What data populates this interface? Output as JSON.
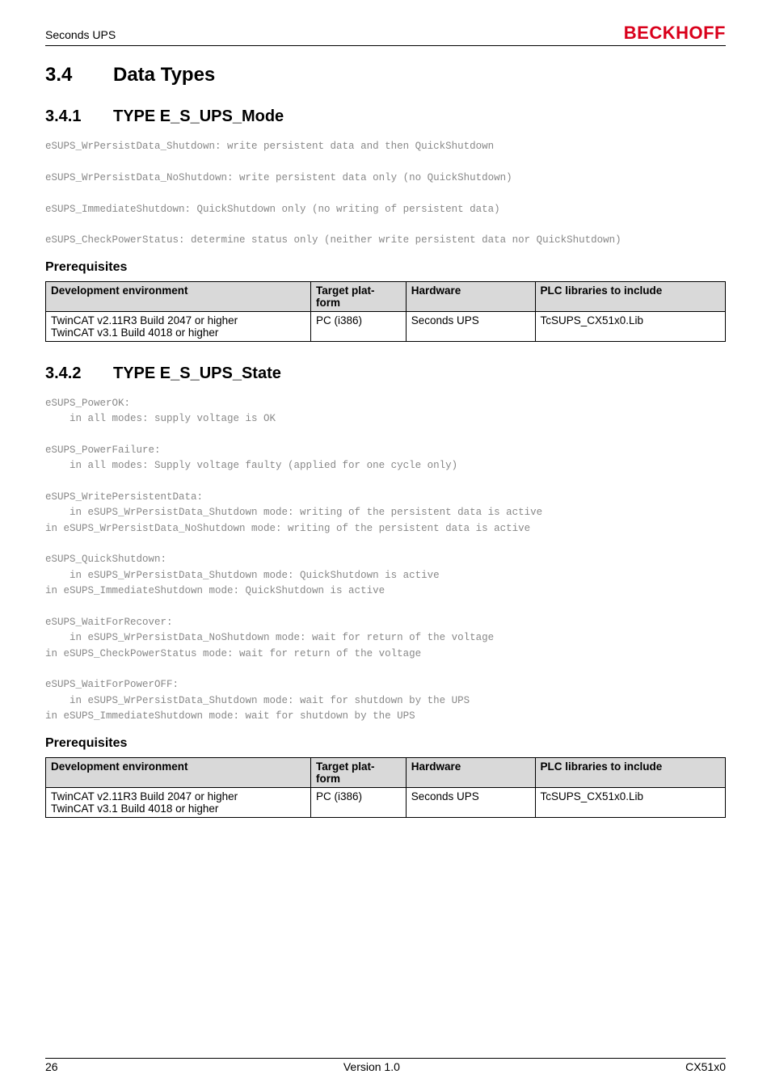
{
  "header": {
    "left": "Seconds UPS",
    "right": "BECKHOFF"
  },
  "h1": {
    "num": "3.4",
    "title": "Data Types"
  },
  "h2a": {
    "num": "3.4.1",
    "title": "TYPE E_S_UPS_Mode"
  },
  "mode_code": "eSUPS_WrPersistData_Shutdown: write persistent data and then QuickShutdown\n\neSUPS_WrPersistData_NoShutdown: write persistent data only (no QuickShutdown)\n\neSUPS_ImmediateShutdown: QuickShutdown only (no writing of persistent data)\n\neSUPS_CheckPowerStatus: determine status only (neither write persistent data nor QuickShutdown)",
  "prereq_label": "Prerequisites",
  "table_headers": {
    "dev": "Development environment",
    "target": "Target plat-\nform",
    "hw": "Hardware",
    "plc": "PLC libraries to include"
  },
  "table1": {
    "dev": "TwinCAT v2.11R3 Build 2047 or higher\nTwinCAT v3.1 Build 4018 or higher",
    "target": "PC (i386)",
    "hw": "Seconds UPS",
    "plc": "TcSUPS_CX51x0.Lib"
  },
  "h2b": {
    "num": "3.4.2",
    "title": "TYPE E_S_UPS_State"
  },
  "state_code": "eSUPS_PowerOK:\n    in all modes: supply voltage is OK\n\neSUPS_PowerFailure:\n    in all modes: Supply voltage faulty (applied for one cycle only)\n\neSUPS_WritePersistentData:\n    in eSUPS_WrPersistData_Shutdown mode: writing of the persistent data is active\nin eSUPS_WrPersistData_NoShutdown mode: writing of the persistent data is active\n\neSUPS_QuickShutdown:\n    in eSUPS_WrPersistData_Shutdown mode: QuickShutdown is active\nin eSUPS_ImmediateShutdown mode: QuickShutdown is active\n\neSUPS_WaitForRecover:\n    in eSUPS_WrPersistData_NoShutdown mode: wait for return of the voltage\nin eSUPS_CheckPowerStatus mode: wait for return of the voltage\n\neSUPS_WaitForPowerOFF:\n    in eSUPS_WrPersistData_Shutdown mode: wait for shutdown by the UPS\nin eSUPS_ImmediateShutdown mode: wait for shutdown by the UPS",
  "table2": {
    "dev": "TwinCAT v2.11R3 Build 2047 or higher\nTwinCAT v3.1 Build 4018 or higher",
    "target": "PC (i386)",
    "hw": "Seconds UPS",
    "plc": "TcSUPS_CX51x0.Lib"
  },
  "footer": {
    "left": "26",
    "center": "Version 1.0",
    "right": "CX51x0"
  }
}
